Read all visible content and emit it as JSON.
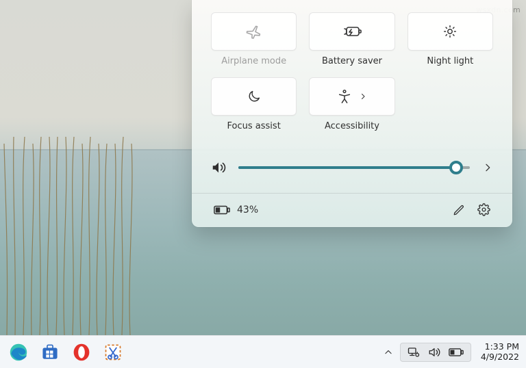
{
  "watermark": "wsxdn.com",
  "quick_settings": {
    "tiles": [
      {
        "id": "airplane-mode",
        "label": "Airplane mode",
        "icon": "airplane-icon",
        "disabled": true
      },
      {
        "id": "battery-saver",
        "label": "Battery saver",
        "icon": "battery-saver-icon",
        "disabled": false
      },
      {
        "id": "night-light",
        "label": "Night light",
        "icon": "night-light-icon",
        "disabled": false
      },
      {
        "id": "focus-assist",
        "label": "Focus assist",
        "icon": "moon-icon",
        "disabled": false
      },
      {
        "id": "accessibility",
        "label": "Accessibility",
        "icon": "accessibility-icon",
        "has_submenu": true,
        "disabled": false
      }
    ],
    "volume": {
      "percent": 94
    },
    "battery": {
      "percent_label": "43%"
    }
  },
  "taskbar": {
    "apps": [
      {
        "id": "edge",
        "name": "edge-icon"
      },
      {
        "id": "ms-store",
        "name": "ms-store-icon"
      },
      {
        "id": "opera",
        "name": "opera-icon"
      },
      {
        "id": "snipping",
        "name": "snipping-tool-icon"
      }
    ],
    "clock": {
      "time": "1:33 PM",
      "date": "4/9/2022"
    }
  }
}
